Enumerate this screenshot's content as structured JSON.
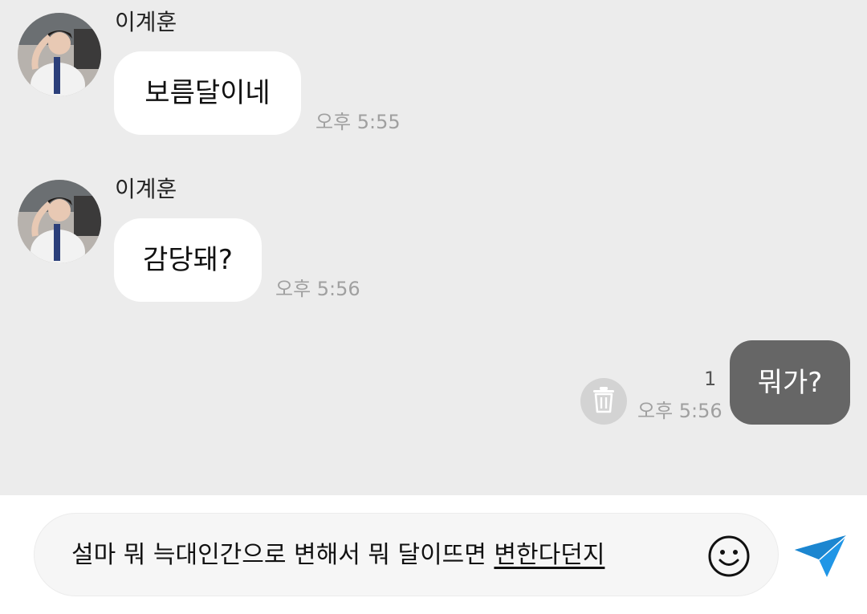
{
  "messages": [
    {
      "sender": "이계훈",
      "text": "보름달이네",
      "time": "오후 5:55"
    },
    {
      "sender": "이계훈",
      "text": "감당돼?",
      "time": "오후 5:56"
    },
    {
      "text": "뭐가?",
      "time": "오후 5:56",
      "unread_count": "1"
    }
  ],
  "composer": {
    "committed_text": "설마 뭐 늑대인간으로 변해서 뭐 달이뜨면 ",
    "composing_text": "변한다던지"
  },
  "icons": {
    "trash": "trash-icon",
    "emoji": "smiley-icon",
    "send": "paper-plane-icon"
  },
  "colors": {
    "chat_background": "#ececec",
    "incoming_bubble": "#ffffff",
    "outgoing_bubble": "#666666",
    "send_accent": "#2196e6",
    "timestamp": "#a0a0a0"
  }
}
